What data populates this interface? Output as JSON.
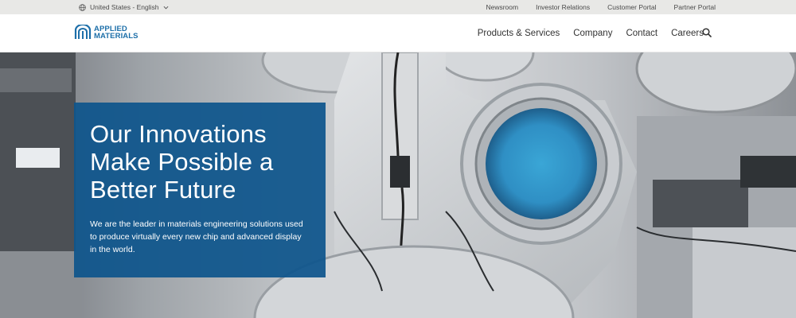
{
  "utility": {
    "locale": "United States - English",
    "links": [
      "Newsroom",
      "Investor Relations",
      "Customer Portal",
      "Partner Portal"
    ]
  },
  "brand": {
    "line1": "APPLIED",
    "line2": "MATERIALS",
    "color": "#1d6fa9"
  },
  "nav": {
    "items": [
      "Products & Services",
      "Company",
      "Contact",
      "Careers"
    ]
  },
  "hero": {
    "title": "Our Innovations Make Possible a Better Future",
    "description": "We are the leader in materials engineering solutions used to produce virtually every new chip and advanced display in the world.",
    "card_color": "#0e558c"
  },
  "icons": {
    "locale": "globe-icon",
    "dropdown": "chevron-down-icon",
    "search": "search-icon"
  }
}
